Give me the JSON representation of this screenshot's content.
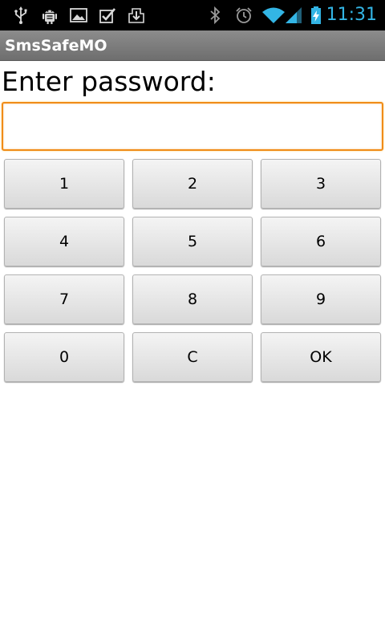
{
  "status_bar": {
    "time": "11:31",
    "time_color": "#33b5e5",
    "left_icons": [
      "usb-icon",
      "android-debug-icon",
      "image-icon",
      "checkbox-icon",
      "download-icon"
    ],
    "right_icons": [
      "bluetooth-icon",
      "alarm-icon",
      "wifi-icon",
      "signal-icon",
      "battery-charging-icon"
    ]
  },
  "app": {
    "title": "SmsSafeMO"
  },
  "form": {
    "prompt": "Enter password:",
    "password_value": "",
    "focus_color": "#f08c18"
  },
  "keypad": {
    "keys": [
      "1",
      "2",
      "3",
      "4",
      "5",
      "6",
      "7",
      "8",
      "9",
      "0",
      "C",
      "OK"
    ]
  }
}
